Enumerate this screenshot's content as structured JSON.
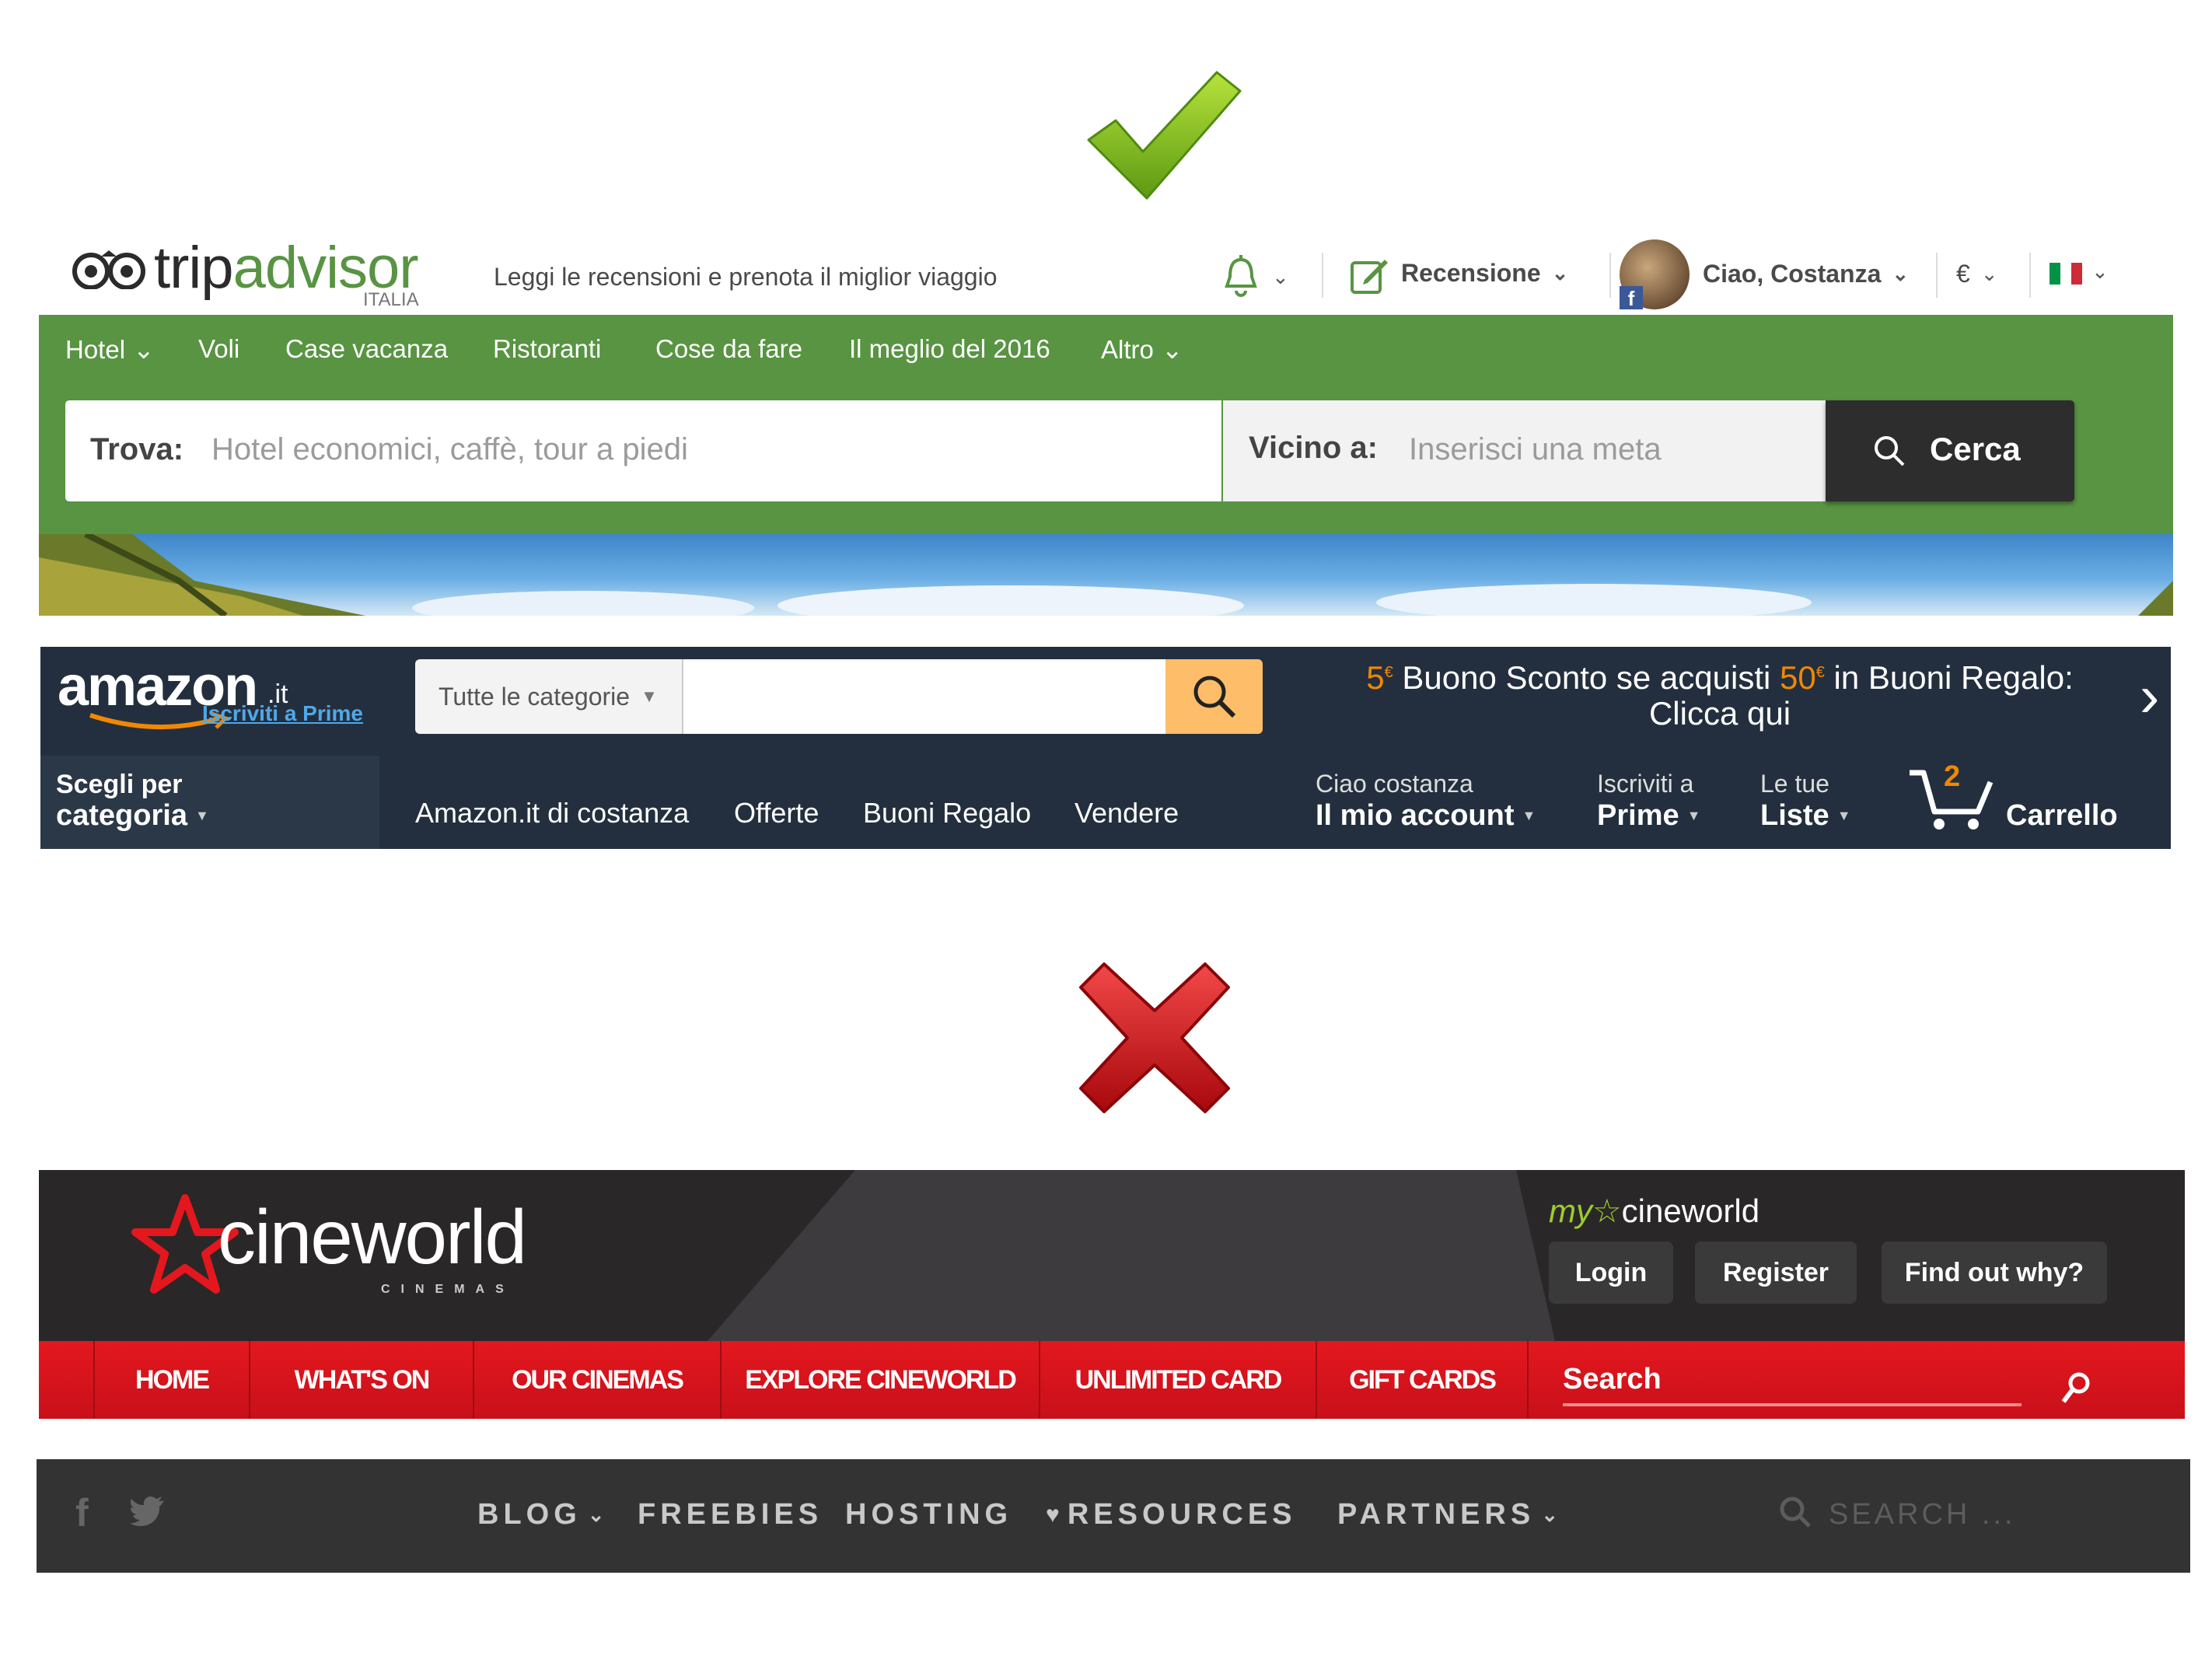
{
  "marks": {
    "good_icon": "green-checkmark",
    "bad_icon": "red-cross"
  },
  "tripadvisor": {
    "logo_trip": "trip",
    "logo_advisor": "advisor",
    "logo_sub": "ITALIA",
    "tagline": "Leggi le recensioni e prenota il miglior viaggio",
    "review_label": "Recensione",
    "greeting": "Ciao, Costanza",
    "currency": "€",
    "nav": [
      "Hotel",
      "Voli",
      "Case vacanza",
      "Ristoranti",
      "Cose da fare",
      "Il meglio del 2016",
      "Altro"
    ],
    "find_label": "Trova:",
    "find_placeholder": "Hotel economici, caffè, tour a piedi",
    "near_label": "Vicino a:",
    "near_placeholder": "Inserisci una meta",
    "search_button": "Cerca",
    "brand_green": "#589442"
  },
  "amazon": {
    "logo": "amazon",
    "logo_tld": ".it",
    "prime_link": "Iscriviti a Prime",
    "category_select": "Tutte le categorie",
    "promo_amount1": "5",
    "promo_text1": "Buono Sconto se acquisti",
    "promo_amount2": "50",
    "promo_text2": "in Buoni Regalo:",
    "promo_line2": "Clicca qui",
    "dept_line1": "Scegli per",
    "dept_line2": "categoria",
    "nav": [
      "Amazon.it di costanza",
      "Offerte",
      "Buoni Regalo",
      "Vendere"
    ],
    "account_small": "Ciao costanza",
    "account_big": "Il mio account",
    "prime_small": "Iscriviti a",
    "prime_big": "Prime",
    "lists_small": "Le tue",
    "lists_big": "Liste",
    "cart_count": "2",
    "cart_label": "Carrello",
    "accent": "#f08804"
  },
  "cineworld": {
    "logo": "cineworld",
    "logo_sub": "CINEMAS",
    "my_prefix": "my",
    "my_name": "cineworld",
    "buttons": [
      "Login",
      "Register",
      "Find out why?"
    ],
    "nav": [
      "HOME",
      "WHAT'S ON",
      "OUR CINEMAS",
      "EXPLORE CINEWORLD",
      "UNLIMITED CARD",
      "GIFT CARDS"
    ],
    "search": "Search",
    "brand_red": "#e4171e"
  },
  "darkbar": {
    "nav": [
      "BLOG",
      "FREEBIES",
      "HOSTING",
      "RESOURCES",
      "PARTNERS"
    ],
    "search_placeholder": "SEARCH ..."
  }
}
